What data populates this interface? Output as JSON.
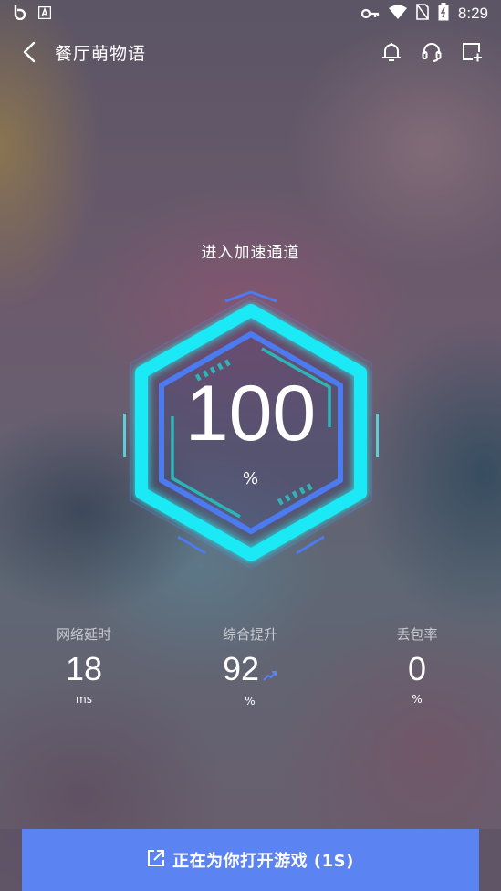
{
  "status_bar": {
    "time": "8:29",
    "left_icons": [
      "b-app-icon",
      "a-app-icon"
    ],
    "right_icons": [
      "key-icon",
      "wifi-icon",
      "no-sim-icon",
      "battery-icon"
    ]
  },
  "header": {
    "title": "餐厅萌物语",
    "actions": [
      "bell-icon",
      "headset-icon",
      "add-shortcut-icon"
    ]
  },
  "accelerator": {
    "status": "进入加速通道",
    "value": "100",
    "unit": "%",
    "progress_percent": 100,
    "ring_color": "#1de9f6",
    "inner_color": "#4c7bf0"
  },
  "stats": [
    {
      "label": "网络延时",
      "value": "18",
      "unit": "ms"
    },
    {
      "label": "综合提升",
      "value": "92",
      "unit": "%",
      "trend": "up-arrow-icon"
    },
    {
      "label": "丢包率",
      "value": "0",
      "unit": "%"
    }
  ],
  "open_button": {
    "label": "正在为你打开游戏 (1S)",
    "icon": "external-link-icon",
    "color": "#5b83f2"
  }
}
